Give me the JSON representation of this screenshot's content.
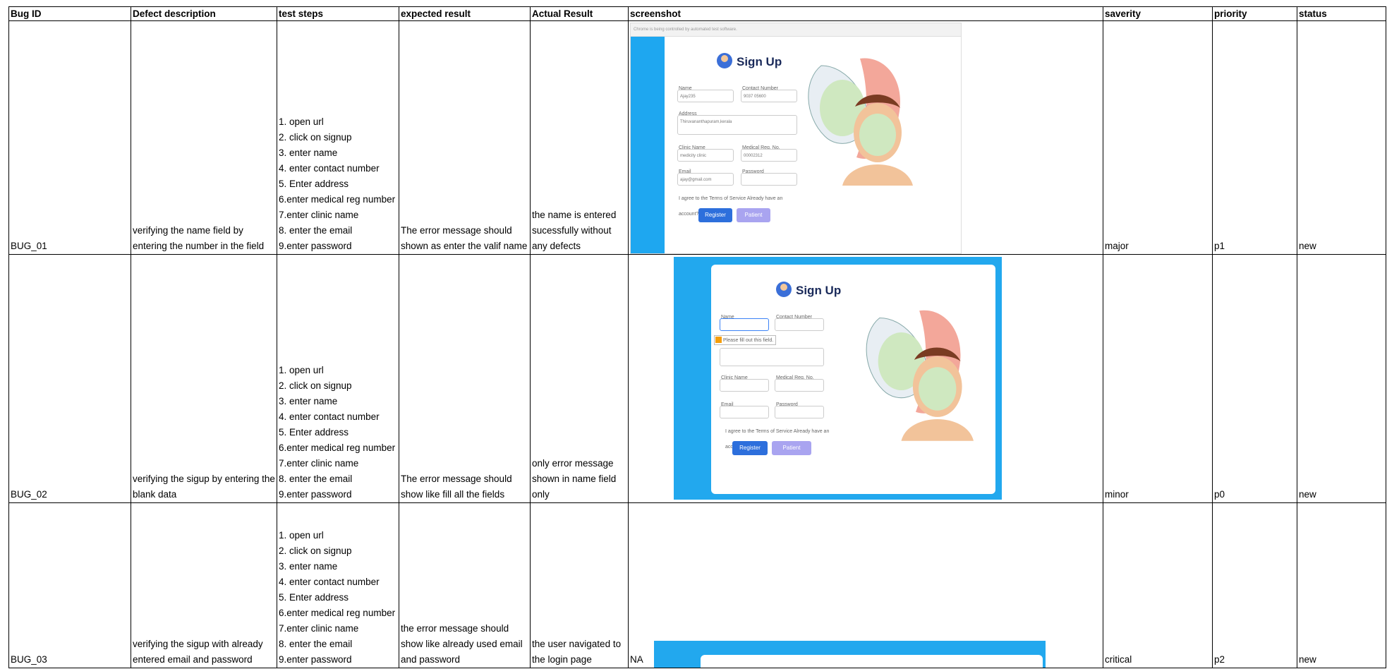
{
  "headers": [
    "Bug ID",
    "Defect description",
    "test steps",
    "expected result",
    "Actual Result",
    "screenshot",
    "saverity",
    "priority",
    "status"
  ],
  "rows": [
    {
      "bug_id": "BUG_01",
      "description": "verifying the name field by entering the number in the field",
      "steps": [
        "1. open url",
        "2. click on signup",
        "3. enter name",
        "4. enter contact number",
        "5. Enter address",
        "6.enter medical reg number",
        "7.enter clinic name",
        "8. enter the email",
        "9.enter password"
      ],
      "expected": "The error message should shown as enter the valif name",
      "actual": "the name is entered sucessfully without any defects",
      "screenshot_note": "",
      "severity": "major",
      "priority": "p1",
      "status": "new"
    },
    {
      "bug_id": "BUG_02",
      "description": "verifying the sigup by entering the blank data",
      "steps": [
        "1. open url",
        "2. click on signup",
        "3. enter name",
        "4. enter contact number",
        "5. Enter address",
        "6.enter medical reg number",
        "7.enter clinic name",
        "8. enter the email",
        "9.enter password"
      ],
      "expected": "The error message should show like fill all the fields",
      "actual": "only error message shown in name field only",
      "screenshot_note": "",
      "severity": "minor",
      "priority": "p0",
      "status": "new"
    },
    {
      "bug_id": "BUG_03",
      "description": "verifying the sigup with already entered email and password",
      "steps": [
        "1. open url",
        "2. click on signup",
        "3. enter name",
        "4. enter contact number",
        "5. Enter address",
        "6.enter medical reg number",
        "7.enter clinic name",
        "8. enter the email",
        "9.enter password"
      ],
      "expected": "the error message should show like already used email and password",
      "actual": "the user navigated to the login page",
      "screenshot_note": "NA",
      "severity": "critical",
      "priority": "p2",
      "status": "new"
    }
  ],
  "mock_form": {
    "browser_bar": "Chrome is being controlled by automated test software.",
    "title": "Sign Up",
    "name_label": "Name",
    "contact_label": "Contact Number",
    "address_label": "Address",
    "clinic_label": "Clinic Name",
    "medreg_label": "Medical Reg. No.",
    "email_label": "Email",
    "password_label": "Password",
    "name_value": "Ajay235",
    "contact_value": "9037 05600",
    "address_value": "Thiruvananthapuram,kerala",
    "clinic_value": "medicity clinic",
    "medreg_value": "00002312",
    "email_value": "ajay@gmail.com",
    "terms_text": "I agree to the Terms of Service  Already have an account? Sign in",
    "tooltip": "Please fill out this field.",
    "register": "Register",
    "patient": "Patient"
  },
  "colors": {
    "blue": "#1ea7f0",
    "button": "#2d6fdc"
  }
}
